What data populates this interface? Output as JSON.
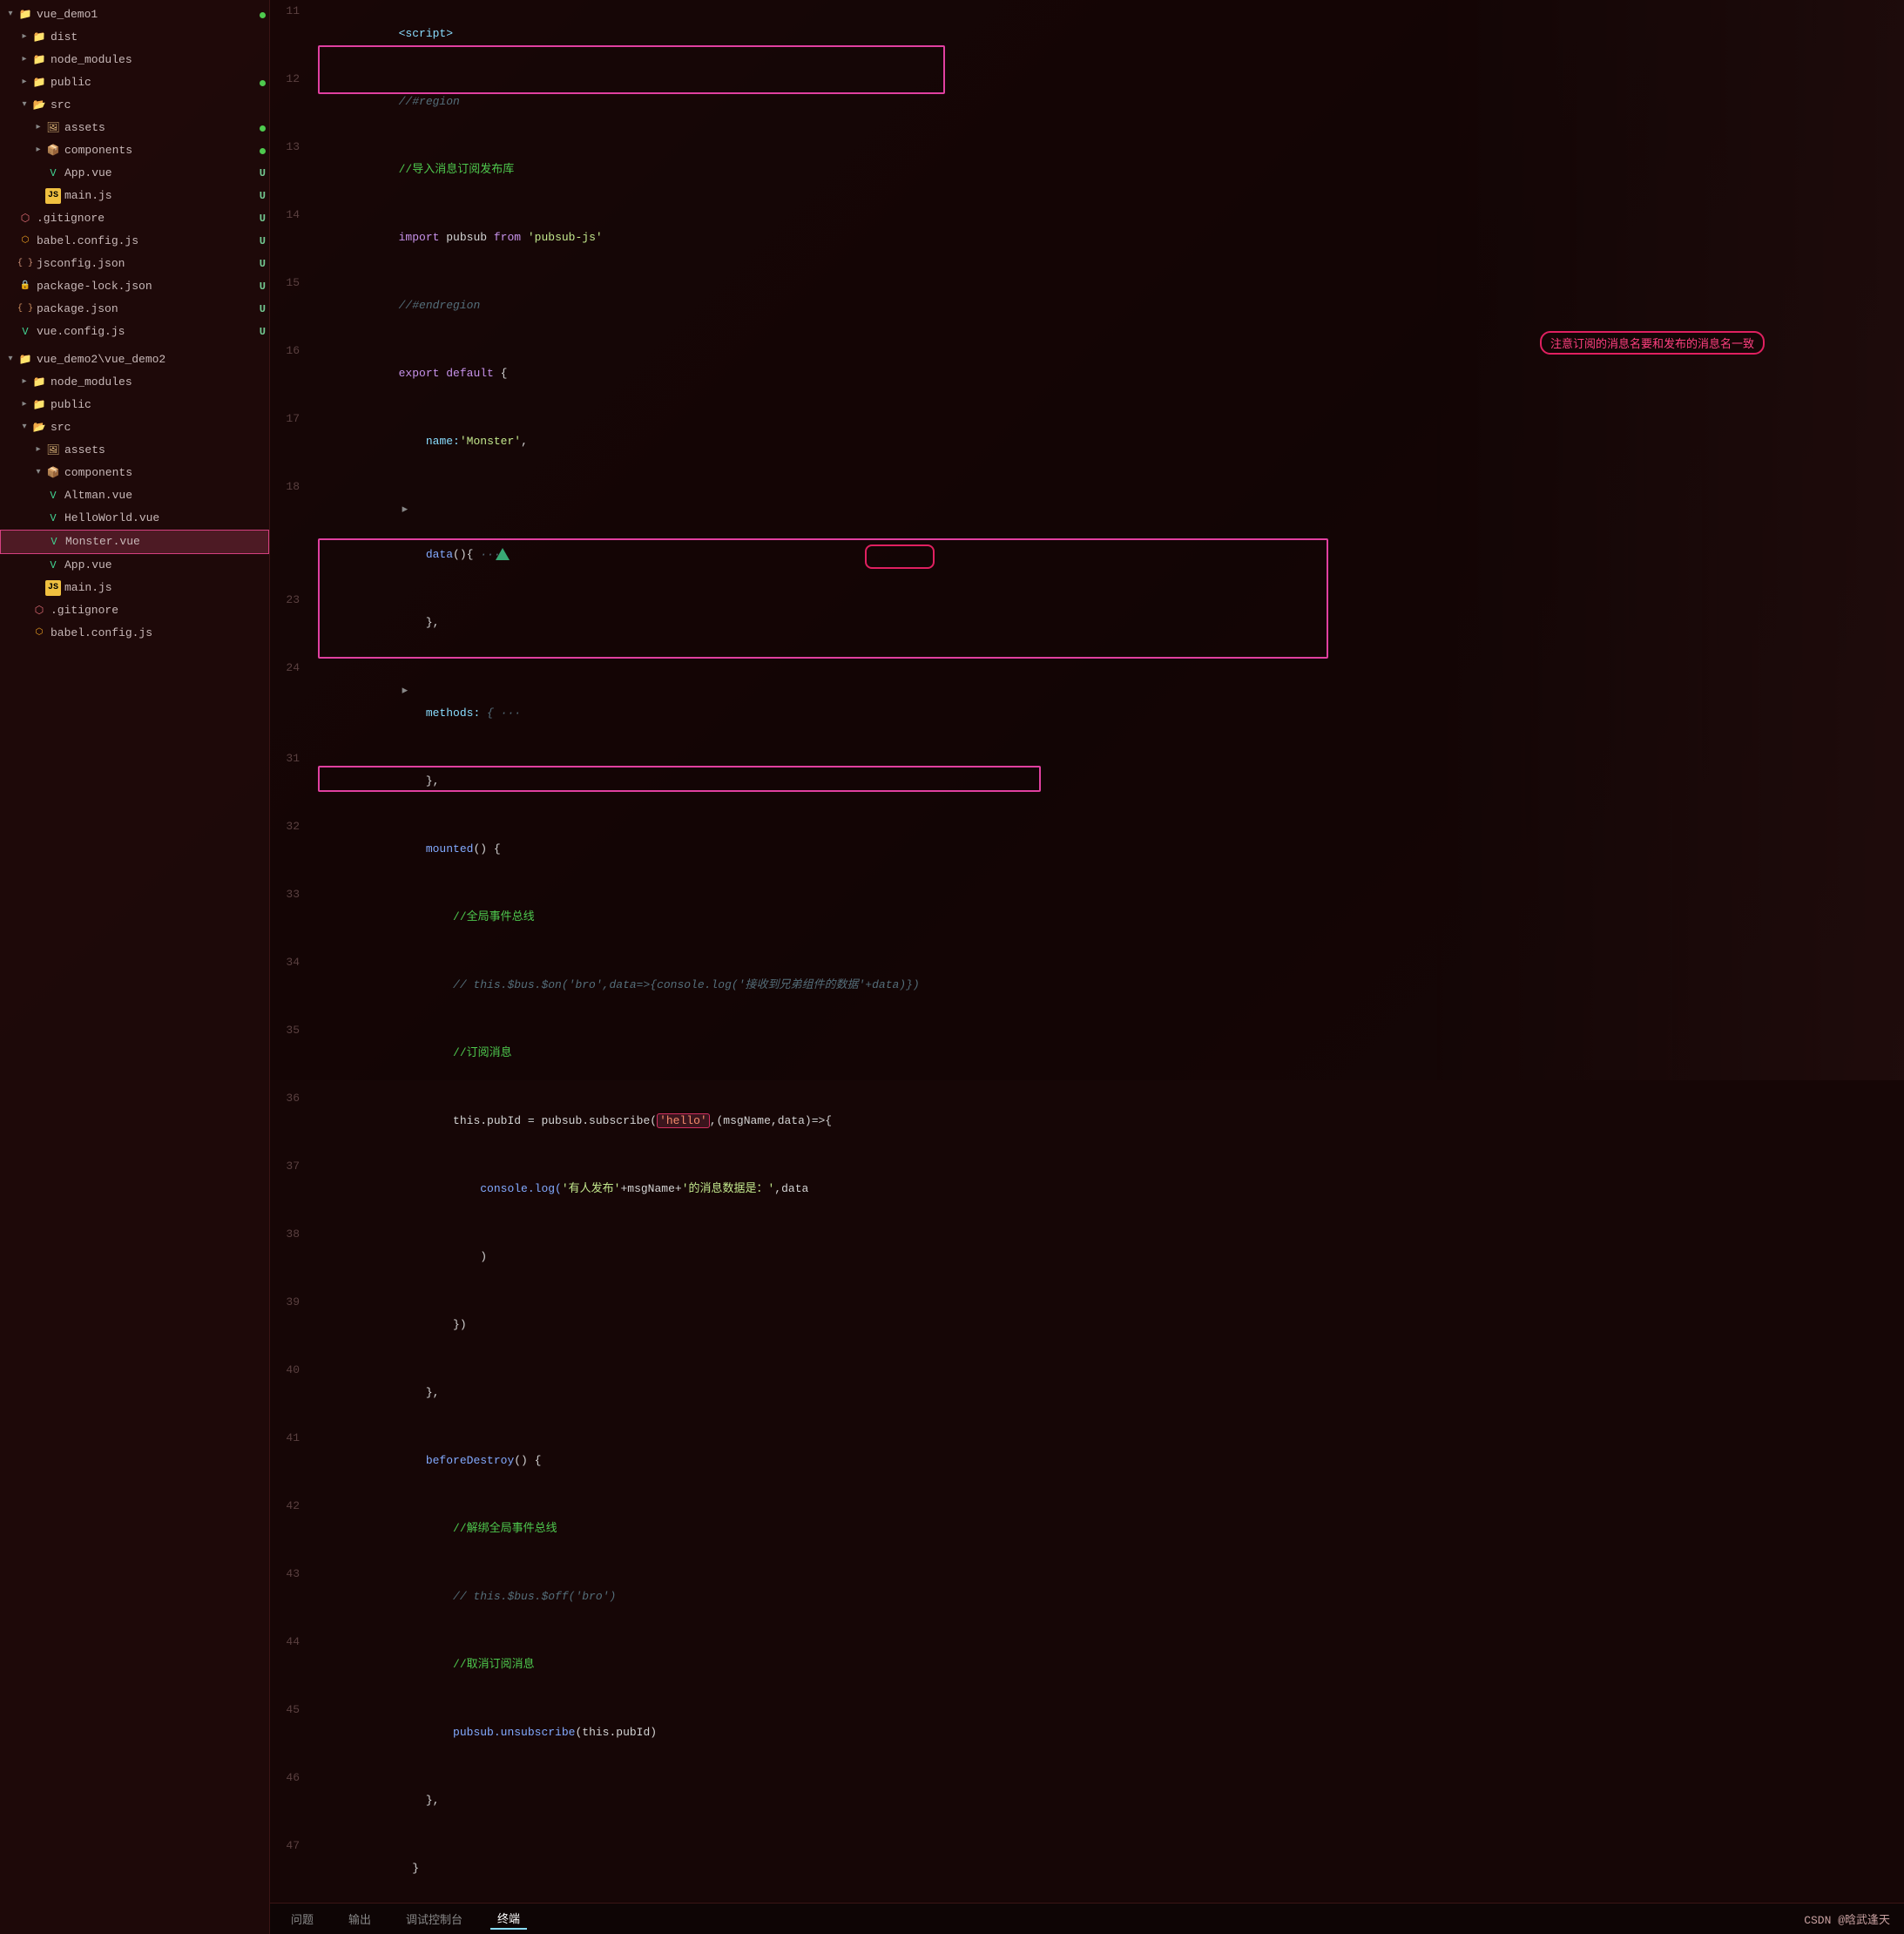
{
  "sidebar": {
    "projects": [
      {
        "name": "vue_demo1",
        "type": "folder-root",
        "expanded": true,
        "badge": "green-dot",
        "children": [
          {
            "name": "dist",
            "type": "folder",
            "expanded": false,
            "indent": 1
          },
          {
            "name": "node_modules",
            "type": "folder",
            "expanded": false,
            "indent": 1
          },
          {
            "name": "public",
            "type": "folder",
            "expanded": false,
            "indent": 1,
            "badge": "green-dot"
          },
          {
            "name": "src",
            "type": "folder",
            "expanded": true,
            "indent": 1,
            "children": [
              {
                "name": "assets",
                "type": "folder",
                "expanded": false,
                "indent": 2,
                "badge": "green-dot"
              },
              {
                "name": "components",
                "type": "folder",
                "expanded": false,
                "indent": 2,
                "badge": "green-dot"
              },
              {
                "name": "App.vue",
                "type": "vue",
                "indent": 3,
                "badge": "U"
              },
              {
                "name": "main.js",
                "type": "js",
                "indent": 3,
                "badge": "U"
              }
            ]
          },
          {
            "name": ".gitignore",
            "type": "gitignore",
            "indent": 1,
            "badge": "U"
          },
          {
            "name": "babel.config.js",
            "type": "babel",
            "indent": 1,
            "badge": "U"
          },
          {
            "name": "jsconfig.json",
            "type": "json",
            "indent": 1,
            "badge": "U"
          },
          {
            "name": "package-lock.json",
            "type": "pkg",
            "indent": 1,
            "badge": "U"
          },
          {
            "name": "package.json",
            "type": "json",
            "indent": 1,
            "badge": "U"
          },
          {
            "name": "vue.config.js",
            "type": "vue",
            "indent": 1,
            "badge": "U"
          }
        ]
      },
      {
        "name": "vue_demo2\\vue_demo2",
        "type": "folder-root",
        "expanded": true,
        "badge": "none",
        "children": [
          {
            "name": "node_modules",
            "type": "folder",
            "expanded": false,
            "indent": 1
          },
          {
            "name": "public",
            "type": "folder",
            "expanded": false,
            "indent": 1
          },
          {
            "name": "src",
            "type": "folder",
            "expanded": true,
            "indent": 1,
            "children": [
              {
                "name": "assets",
                "type": "folder",
                "expanded": false,
                "indent": 2
              },
              {
                "name": "components",
                "type": "folder",
                "expanded": true,
                "indent": 2,
                "children": [
                  {
                    "name": "Altman.vue",
                    "type": "vue",
                    "indent": 3
                  },
                  {
                    "name": "HelloWorld.vue",
                    "type": "vue",
                    "indent": 3
                  },
                  {
                    "name": "Monster.vue",
                    "type": "vue",
                    "indent": 3,
                    "selected": true
                  }
                ]
              },
              {
                "name": "App.vue",
                "type": "vue",
                "indent": 3
              },
              {
                "name": "main.js",
                "type": "js",
                "indent": 3
              },
              {
                "name": ".gitignore",
                "type": "gitignore",
                "indent": 2
              },
              {
                "name": "babel.config.js",
                "type": "babel",
                "indent": 2
              }
            ]
          }
        ]
      }
    ]
  },
  "code": {
    "lines": [
      {
        "num": 11,
        "tokens": [
          {
            "t": "<script>",
            "c": "kw2"
          }
        ]
      },
      {
        "num": 12,
        "tokens": [
          {
            "t": "//#region",
            "c": "cmt"
          }
        ]
      },
      {
        "num": 13,
        "tokens": [
          {
            "t": "//导入消息订阅发布库",
            "c": "cmt-green"
          }
        ]
      },
      {
        "num": 14,
        "tokens": [
          {
            "t": "import ",
            "c": "kw"
          },
          {
            "t": "pubsub",
            "c": "plain"
          },
          {
            "t": " from ",
            "c": "kw"
          },
          {
            "t": "'pubsub-js'",
            "c": "str"
          }
        ]
      },
      {
        "num": 15,
        "tokens": [
          {
            "t": "//#endregion",
            "c": "cmt"
          }
        ]
      },
      {
        "num": 16,
        "tokens": [
          {
            "t": "export ",
            "c": "kw"
          },
          {
            "t": "default ",
            "c": "kw"
          },
          {
            "t": "{",
            "c": "plain"
          }
        ]
      },
      {
        "num": 17,
        "tokens": [
          {
            "t": "    name:",
            "c": "prop"
          },
          {
            "t": "'Monster'",
            "c": "str"
          },
          {
            "t": ",",
            "c": "plain"
          }
        ]
      },
      {
        "num": 18,
        "tokens": [
          {
            "t": "    data",
            "c": "fn"
          },
          {
            "t": "(){",
            "c": "plain"
          },
          {
            "t": " ···",
            "c": "cmt"
          }
        ],
        "collapsed": true
      },
      {
        "num": 23,
        "tokens": [
          {
            "t": "    },",
            "c": "plain"
          }
        ]
      },
      {
        "num": 24,
        "tokens": [
          {
            "t": "    methods: ",
            "c": "prop"
          },
          {
            "t": "{ ···",
            "c": "cmt"
          }
        ],
        "collapsed": true
      },
      {
        "num": 31,
        "tokens": [
          {
            "t": "    },",
            "c": "plain"
          }
        ]
      },
      {
        "num": 32,
        "tokens": [
          {
            "t": "    mounted",
            "c": "fn"
          },
          {
            "t": "() {",
            "c": "plain"
          }
        ]
      },
      {
        "num": 33,
        "tokens": [
          {
            "t": "        //全局事件总线",
            "c": "cmt-green"
          }
        ]
      },
      {
        "num": 34,
        "tokens": [
          {
            "t": "        // this.$bus.$on",
            "c": "cmt"
          },
          {
            "t": "('bro',data=>{console.log(",
            "c": "cmt"
          },
          {
            "t": "'接收到兄弟组件的数据'",
            "c": "cmt"
          },
          {
            "t": "+data)})",
            "c": "cmt"
          }
        ]
      },
      {
        "num": 35,
        "tokens": [
          {
            "t": "        //订阅消息",
            "c": "cmt-green"
          }
        ]
      },
      {
        "num": 36,
        "tokens": [
          {
            "t": "        this.pubId = pubsub.subscribe(",
            "c": "plain"
          },
          {
            "t": "'hello'",
            "c": "str-hl"
          },
          {
            "t": ",(msgName,data)=>{",
            "c": "plain"
          }
        ]
      },
      {
        "num": 37,
        "tokens": [
          {
            "t": "            console.log(",
            "c": "fn"
          },
          {
            "t": "'有人发布'",
            "c": "str"
          },
          {
            "t": "+msgName+",
            "c": "plain"
          },
          {
            "t": "'的消息数据是：'",
            "c": "str"
          },
          {
            "t": ",data",
            "c": "plain"
          }
        ]
      },
      {
        "num": 38,
        "tokens": [
          {
            "t": "            )",
            "c": "plain"
          }
        ]
      },
      {
        "num": 39,
        "tokens": [
          {
            "t": "        })",
            "c": "plain"
          }
        ]
      },
      {
        "num": 40,
        "tokens": [
          {
            "t": "    },",
            "c": "plain"
          }
        ]
      },
      {
        "num": 41,
        "tokens": [
          {
            "t": "    beforeDestroy",
            "c": "fn"
          },
          {
            "t": "() {",
            "c": "plain"
          }
        ]
      },
      {
        "num": 42,
        "tokens": [
          {
            "t": "        //解绑全局事件总线",
            "c": "cmt-green"
          }
        ]
      },
      {
        "num": 43,
        "tokens": [
          {
            "t": "        // this.$bus.$off",
            "c": "cmt"
          },
          {
            "t": "('bro')",
            "c": "cmt"
          }
        ]
      },
      {
        "num": 44,
        "tokens": [
          {
            "t": "        //取消订阅消息",
            "c": "cmt-green"
          }
        ]
      },
      {
        "num": 45,
        "tokens": [
          {
            "t": "        pubsub.unsubscribe",
            "c": "fn"
          },
          {
            "t": "(this.pubId)",
            "c": "plain"
          }
        ]
      },
      {
        "num": 46,
        "tokens": [
          {
            "t": "    },",
            "c": "plain"
          }
        ]
      },
      {
        "num": 47,
        "tokens": [
          {
            "t": "  }",
            "c": "plain"
          }
        ]
      }
    ]
  },
  "annotations": {
    "subscribe_note": "注意订阅的消息名要和发布的消息名一致"
  },
  "statusbar": {
    "items": [
      "问题",
      "输出",
      "调试控制台",
      "终端"
    ],
    "active": "终端",
    "right": "CSDN @晗武逢天"
  }
}
